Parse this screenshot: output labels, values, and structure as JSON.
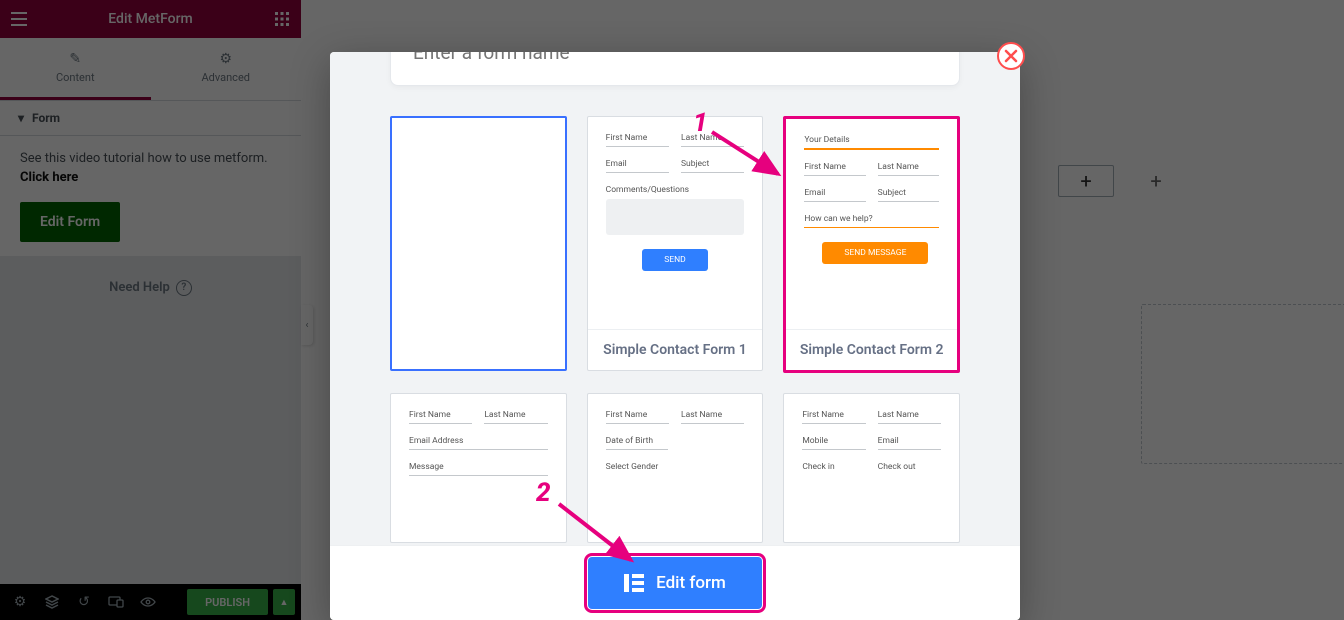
{
  "sidebar": {
    "title": "Edit MetForm",
    "tabs": {
      "content": "Content",
      "advanced": "Advanced"
    },
    "section_title": "Form",
    "tip_text": "See this video tutorial how to use metform. ",
    "tip_link": "Click here",
    "edit_form_btn": "Edit Form",
    "need_help": "Need Help",
    "publish": "PUBLISH"
  },
  "canvas": {
    "collapse_caret": "‹"
  },
  "modal": {
    "name_placeholder": "Enter a form name",
    "templates": {
      "t1": {
        "title": "Simple Contact Form 1",
        "fields": {
          "fn": "First Name",
          "ln": "Last Name",
          "em": "Email",
          "sb": "Subject",
          "cq": "Comments/Questions"
        },
        "btn": "SEND"
      },
      "t2": {
        "title": "Simple Contact Form 2",
        "fields": {
          "yd": "Your Details",
          "fn": "First Name",
          "ln": "Last Name",
          "em": "Email",
          "sb": "Subject",
          "hw": "How can we help?"
        },
        "btn": "SEND MESSAGE"
      },
      "t3": {
        "fields": {
          "fn": "First Name",
          "ln": "Last Name",
          "ea": "Email Address",
          "ms": "Message"
        }
      },
      "t4": {
        "fields": {
          "fn": "First Name",
          "ln": "Last Name",
          "db": "Date of Birth",
          "sg": "Select Gender"
        }
      },
      "t5": {
        "fields": {
          "fn": "First Name",
          "ln": "Last Name",
          "mb": "Mobile",
          "em": "Email",
          "ci": "Check in",
          "co": "Check out"
        }
      }
    },
    "edit_form_btn": "Edit form"
  },
  "annotations": {
    "n1": "1",
    "n2": "2"
  }
}
